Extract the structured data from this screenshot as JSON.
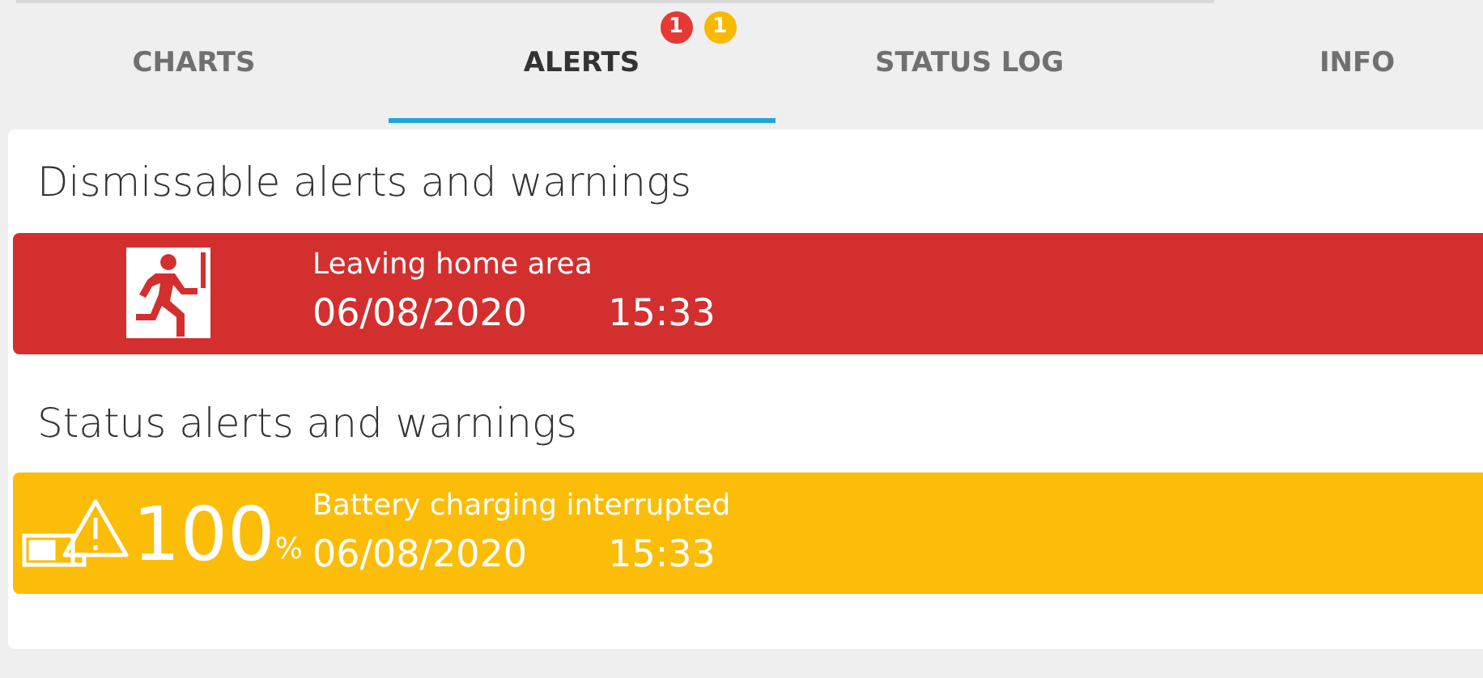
{
  "tabs": [
    {
      "label": "CHARTS",
      "selected": false
    },
    {
      "label": "ALERTS",
      "selected": true,
      "badges": [
        {
          "count": "1",
          "color": "#e53935"
        },
        {
          "count": "1",
          "color": "#f9b900"
        }
      ]
    },
    {
      "label": "STATUS LOG",
      "selected": false
    },
    {
      "label": "INFO",
      "selected": false
    }
  ],
  "sections": [
    {
      "title": "Dismissable alerts and warnings",
      "alerts": [
        {
          "kind": "exit",
          "color": "#d32f2f",
          "message": "Leaving home area",
          "date": "06/08/2020",
          "time": "15:33"
        }
      ]
    },
    {
      "title": "Status alerts and warnings",
      "alerts": [
        {
          "kind": "battery",
          "color": "#fbbd08",
          "percent": "100",
          "unit": "%",
          "message": "Battery charging interrupted",
          "date": "06/08/2020",
          "time": "15:33"
        }
      ]
    }
  ]
}
